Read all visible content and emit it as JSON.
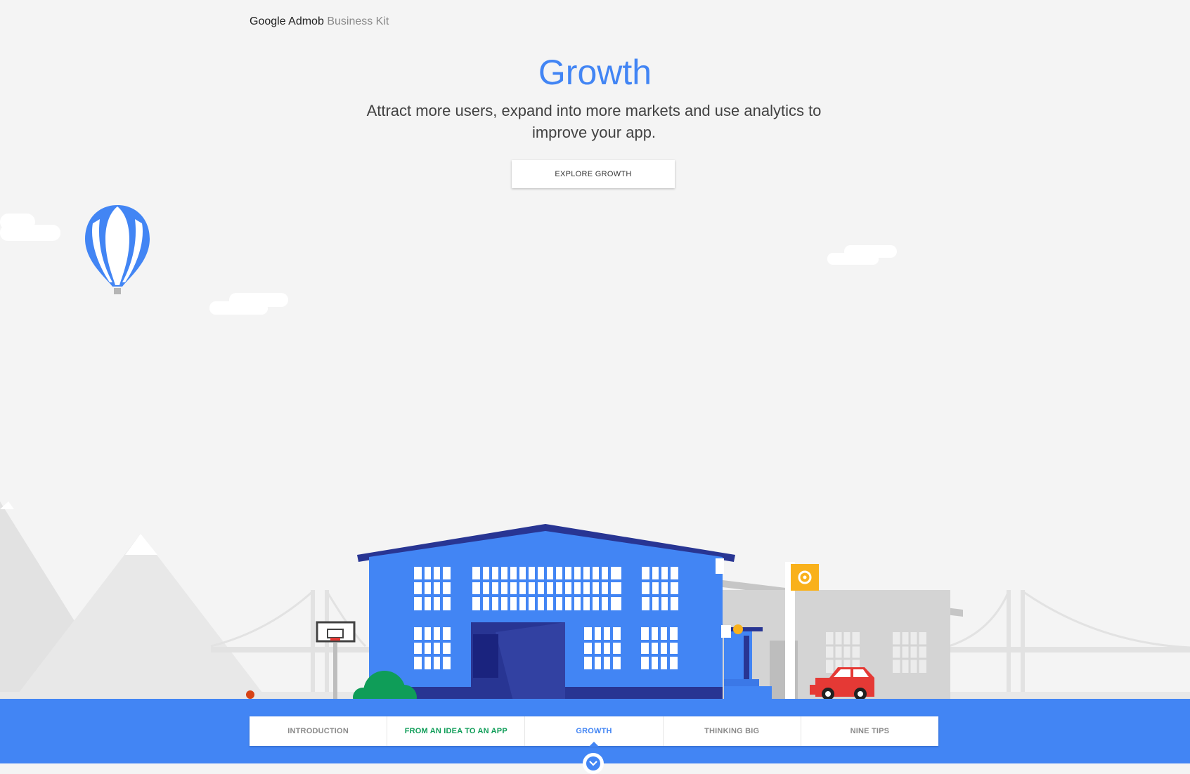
{
  "brand": {
    "name": "Google Admob",
    "sub": "Business Kit"
  },
  "hero": {
    "title": "Growth",
    "description": "Attract more users, expand into more markets and use analytics to improve your app.",
    "cta": "EXPLORE GROWTH"
  },
  "nav": {
    "tabs": [
      {
        "label": "INTRODUCTION",
        "state": "default"
      },
      {
        "label": "FROM AN IDEA TO AN APP",
        "state": "highlight"
      },
      {
        "label": "GROWTH",
        "state": "active"
      },
      {
        "label": "THINKING BIG",
        "state": "default"
      },
      {
        "label": "NINE TIPS",
        "state": "default"
      }
    ]
  },
  "icons": {
    "scroll_down": "chevron-down-icon",
    "sign": "target-sign-icon"
  },
  "colors": {
    "accent": "#4285f4",
    "green": "#0f9d58",
    "building": "#4285f4",
    "roof": "#283593",
    "car": "#e53935",
    "sign": "#f9b11b",
    "bush": "#0f9d58"
  }
}
